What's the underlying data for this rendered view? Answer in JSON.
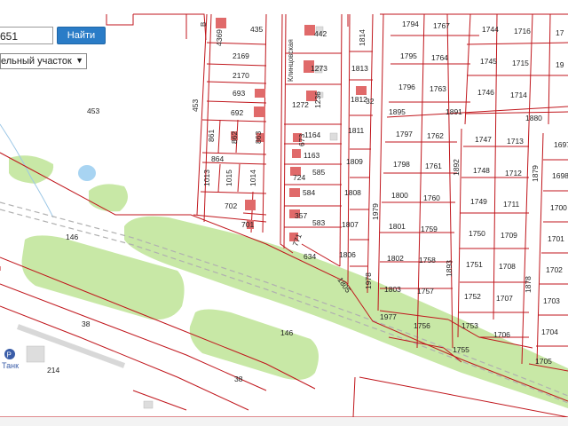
{
  "search": {
    "value": "651",
    "button_label": "Найти"
  },
  "layer_select": {
    "selected": "ельный участок"
  },
  "map": {
    "street_label": "Клинцовская",
    "rail_label_top": "146",
    "rail_label_mid": "146",
    "road_label_left": "38",
    "road_label_bottom": "38",
    "poi_label": "Танк",
    "poi_number": "214",
    "big_parcel": "453",
    "side_parcel": "453",
    "parcels": {
      "a4369": "4369",
      "a435": "435",
      "a2169": "2169",
      "a2170": "2170",
      "a693": "693",
      "a692": "692",
      "a861": "861",
      "a862": "862",
      "a863": "863",
      "a864": "864",
      "a1013": "1013",
      "a1015": "1015",
      "a1014": "1014",
      "a702": "702",
      "a701": "701",
      "a442": "442",
      "a1273": "1273",
      "a1272": "1272",
      "a1236": "1236",
      "a1164": "1164",
      "a1163": "1163",
      "a673": "673",
      "a585": "585",
      "a724": "724",
      "a584": "584",
      "a357": "357",
      "a583": "583",
      "a771": "771",
      "a634": "634",
      "a1814": "1814",
      "a1813": "1813",
      "a1812": "1812",
      "a32": "32",
      "a1811": "1811",
      "a1809": "1809",
      "a1808": "1808",
      "a1807": "1807",
      "a1806": "1806",
      "a1805": "1805",
      "a1979": "1979",
      "a1978": "1978",
      "a1977": "1977",
      "a1794": "1794",
      "a1767": "1767",
      "a1795": "1795",
      "a1764": "1764",
      "a1796": "1796",
      "a1763": "1763",
      "a1895": "1895",
      "a1891": "1891",
      "a1797": "1797",
      "a1762": "1762",
      "a1798": "1798",
      "a1761": "1761",
      "a1800": "1800",
      "a1760": "1760",
      "a1801": "1801",
      "a1759": "1759",
      "a1802": "1802",
      "a1758": "1758",
      "a1803": "1803",
      "a1757": "1757",
      "a1756": "1756",
      "a1755": "1755",
      "a1892": "1892",
      "a1893": "1893",
      "a1744": "1744",
      "a1716": "1716",
      "a1745": "1745",
      "a1715": "1715",
      "a1746": "1746",
      "a1714": "1714",
      "a1880": "1880",
      "a1747": "1747",
      "a1713": "1713",
      "a1748": "1748",
      "a1712": "1712",
      "a1749": "1749",
      "a1711": "1711",
      "a1750": "1750",
      "a1709": "1709",
      "a1751": "1751",
      "a1708": "1708",
      "a1752": "1752",
      "a1707": "1707",
      "a1753": "1753",
      "a1706": "1706",
      "a1879": "1879",
      "a1878": "1878",
      "a1697": "1697",
      "a1698": "1698",
      "a1700": "1700",
      "a1701": "1701",
      "a1702": "1702",
      "a1703": "1703",
      "a1704": "1704",
      "a1705": "1705"
    }
  },
  "colors": {
    "parcel_border": "#c0161c",
    "building": "#e06a6a",
    "green": "#c8e8a6",
    "water": "#a8d4f2",
    "railway": "#b8b8b8",
    "button": "#2a7cc7",
    "poi": "#3a5da8"
  }
}
